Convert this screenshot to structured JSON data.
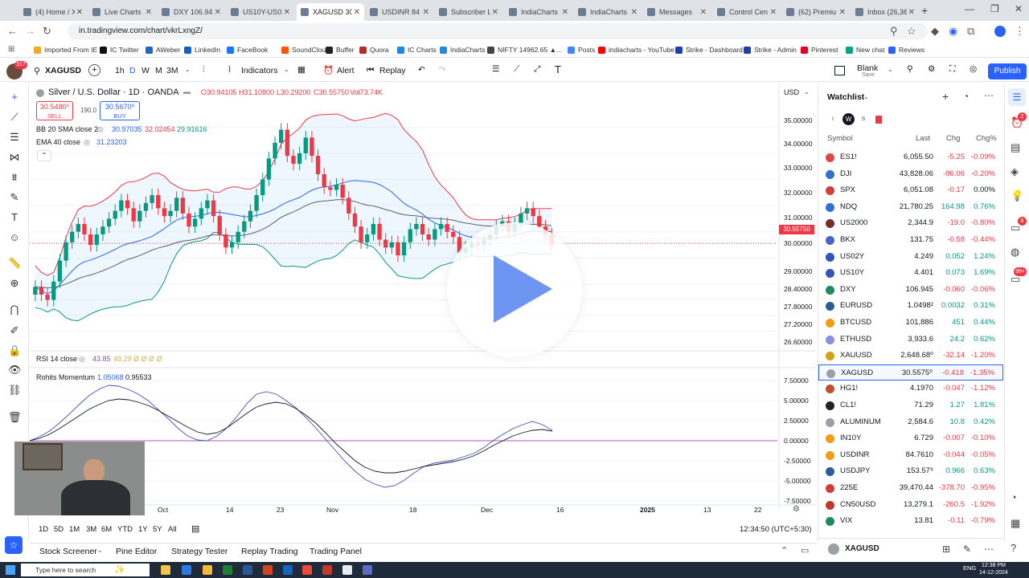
{
  "browser": {
    "tabs": [
      {
        "label": "(4) Home / X"
      },
      {
        "label": "Live Charts"
      },
      {
        "label": "DXY 106.94"
      },
      {
        "label": "US10Y-US02"
      },
      {
        "label": "XAGUSD 30"
      },
      {
        "label": "USDINR 84"
      },
      {
        "label": "Subscriber L"
      },
      {
        "label": "IndiaCharts"
      },
      {
        "label": "IndiaCharts"
      },
      {
        "label": "Messages"
      },
      {
        "label": "Control Cen"
      },
      {
        "label": "(62) Premiu"
      },
      {
        "label": "Inbox (26,36"
      }
    ],
    "url": "in.tradingview.com/chart/vkrLxngZ/",
    "bookmarks": [
      "Imported From IE",
      "IC Twitter",
      "AWeber",
      "LinkedIn",
      "FaceBook",
      "SoundCloud",
      "Buffer",
      "Quora",
      "IC Charts",
      "IndiaCharts",
      "NIFTY 14962.65 ▲...",
      "Posts",
      "indiacharts - YouTube",
      "Strike - Dashboard",
      "Strike - Admin",
      "Pinterest",
      "New chat",
      "Reviews"
    ]
  },
  "toolbar": {
    "symbol": "XAGUSD",
    "badge": "317",
    "intervals": [
      "1h",
      "D",
      "W",
      "M",
      "3M"
    ],
    "indicators": "Indicators",
    "alert": "Alert",
    "replay": "Replay",
    "layout_name": "Blank",
    "layout_sub": "Save",
    "publish": "Publish"
  },
  "chart": {
    "title": "Silver / U.S. Dollar · 1D · OANDA",
    "ohlc": {
      "o": "O30.94105",
      "h": "H31.10800",
      "l": "L30.29200",
      "c": "C30.55750",
      "vol": "Vol73.74K"
    },
    "sell_price": "30.5480⁰",
    "sell_label": "SELL",
    "spread": "190.0",
    "buy_price": "30.5670⁰",
    "buy_label": "BUY",
    "currency": "USD",
    "bb_label": "BB 20 SMA close 2",
    "bb_values": [
      "30.97035",
      "32.02454",
      "29.91616"
    ],
    "ema_label": "EMA 40 close",
    "ema_value": "31.23203",
    "rsi_label": "RSI 14 close",
    "rsi_value": "43.85",
    "rsi_extra": "48.29  Ø Ø Ø Ø",
    "mom_label": "Rohits Momentum",
    "mom_values": [
      "1.05068",
      "0.95533"
    ],
    "price_axis": [
      "35.00000",
      "34.00000",
      "33.00000",
      "32.00000",
      "31.00000",
      "30.00000",
      "29.00000",
      "28.40000",
      "27.80000",
      "27.20000",
      "26.60000"
    ],
    "last_price_tag": "30.55750",
    "mom_axis": [
      "7.50000",
      "5.00000",
      "2.50000",
      "0.00000",
      "-2.50000",
      "-5.00000",
      "-7.50000"
    ],
    "time_axis": [
      "Oct",
      "14",
      "23",
      "Nov",
      "18",
      "Dec",
      "16",
      "2025",
      "13",
      "22"
    ],
    "clock": "12:34:50 (UTC+5:30)",
    "ranges": [
      "1D",
      "5D",
      "1M",
      "3M",
      "6M",
      "YTD",
      "1Y",
      "5Y",
      "All"
    ]
  },
  "chart_data": [
    {
      "type": "candlestick",
      "title": "Silver / U.S. Dollar · 1D · OANDA",
      "y_range": [
        26.3,
        35.5
      ],
      "series": [
        {
          "name": "price_close_approx",
          "values": [
            28.9,
            28.6,
            28.4,
            29.1,
            29.9,
            30.6,
            31.0,
            31.3,
            30.9,
            30.5,
            30.9,
            31.2,
            31.5,
            31.8,
            32.2,
            31.9,
            31.4,
            31.8,
            32.1,
            32.4,
            31.9,
            31.6,
            31.8,
            32.3,
            31.7,
            31.2,
            31.5,
            31.9,
            32.2,
            31.6,
            30.9,
            30.4,
            30.6,
            31.0,
            31.4,
            31.8,
            32.4,
            33.0,
            33.8,
            34.4,
            34.9,
            33.9,
            33.6,
            34.0,
            34.6,
            33.9,
            33.2,
            32.7,
            32.6,
            32.8,
            32.3,
            31.7,
            31.2,
            30.6,
            30.9,
            31.3,
            30.7,
            30.4,
            30.6,
            30.1,
            30.6,
            31.1,
            31.3,
            30.9,
            30.7,
            31.1,
            31.3,
            31.0,
            30.8,
            30.2,
            30.4,
            30.6,
            30.5,
            30.7,
            30.9,
            31.2,
            31.4,
            31.0,
            31.3,
            31.7,
            31.9,
            31.6,
            31.2,
            30.9,
            30.5
          ]
        }
      ]
    },
    {
      "type": "line",
      "title": "Rohits Momentum",
      "y_range": [
        -7.5,
        7.5
      ],
      "series": [
        {
          "name": "1.05068",
          "values": [
            0.0,
            0.5,
            1.2,
            2.2,
            3.3,
            4.5,
            5.6,
            6.4,
            6.9,
            6.8,
            6.4,
            5.8,
            5.0,
            3.9,
            2.8,
            1.6,
            0.6,
            0.1,
            0.0,
            0.6,
            1.6,
            3.0,
            4.6,
            5.8,
            6.1,
            5.8,
            5.0,
            4.1,
            2.9,
            1.6,
            0.2,
            -1.2,
            -2.6,
            -3.8,
            -4.8,
            -5.4,
            -5.8,
            -5.6,
            -4.9,
            -4.0,
            -3.2,
            -2.8,
            -2.6,
            -2.4,
            -2.0,
            -1.6,
            -0.9,
            0.0,
            0.8,
            1.5,
            2.0,
            2.4,
            2.0,
            1.3
          ]
        },
        {
          "name": "0.95533",
          "values": [
            0.0,
            0.3,
            0.8,
            1.5,
            2.3,
            3.1,
            3.9,
            4.5,
            5.0,
            5.2,
            5.1,
            4.8,
            4.4,
            3.8,
            3.1,
            2.4,
            1.7,
            1.1,
            0.8,
            1.0,
            1.6,
            2.5,
            3.4,
            4.2,
            4.6,
            4.8,
            4.6,
            4.0,
            3.2,
            2.2,
            1.0,
            -0.3,
            -1.4,
            -2.5,
            -3.3,
            -3.8,
            -4.0,
            -4.0,
            -3.8,
            -3.5,
            -3.2,
            -3.0,
            -2.8,
            -2.6,
            -2.3,
            -1.9,
            -1.3,
            -0.6,
            0.0,
            0.6,
            1.0,
            1.3,
            1.4,
            1.2
          ]
        }
      ]
    }
  ],
  "watchlist": {
    "title": "Watchlist",
    "headers": [
      "Symbol",
      "Last",
      "Chg",
      "Chg%"
    ],
    "rows": [
      {
        "sym": "ES1!",
        "last": "6,055.50",
        "chg": "-5.25",
        "chgp": "-0.09%",
        "dir": "neg",
        "color": "#e04646"
      },
      {
        "sym": "DJI",
        "last": "43,828.06",
        "chg": "-86.06",
        "chgp": "-0.20%",
        "dir": "neg",
        "color": "#2f6fd8"
      },
      {
        "sym": "SPX",
        "last": "6,051.08",
        "chg": "-0.17",
        "chgp": "0.00%",
        "dir": "neg",
        "color": "#d43c3c"
      },
      {
        "sym": "NDQ",
        "last": "21,780.25",
        "chg": "164.98",
        "chgp": "0.76%",
        "dir": "pos",
        "color": "#2f6fd8"
      },
      {
        "sym": "US2000",
        "last": "2,344.9",
        "chg": "-19.0",
        "chgp": "-0.80%",
        "dir": "neg",
        "color": "#7a2b2b"
      },
      {
        "sym": "BKX",
        "last": "131.75",
        "chg": "-0.58",
        "chgp": "-0.44%",
        "dir": "neg",
        "color": "#4466cc"
      },
      {
        "sym": "US02Y",
        "last": "4.249",
        "chg": "0.052",
        "chgp": "1.24%",
        "dir": "pos",
        "color": "#3355bb"
      },
      {
        "sym": "US10Y",
        "last": "4.401",
        "chg": "0.073",
        "chgp": "1.69%",
        "dir": "pos",
        "color": "#3355bb"
      },
      {
        "sym": "DXY",
        "last": "106.945",
        "chg": "-0.060",
        "chgp": "-0.06%",
        "dir": "neg",
        "color": "#1f8a5a"
      },
      {
        "sym": "EURUSD",
        "last": "1.0498²",
        "chg": "0.0032",
        "chgp": "0.31%",
        "dir": "pos",
        "color": "#2a5d9c"
      },
      {
        "sym": "BTCUSD",
        "last": "101,886",
        "chg": "451",
        "chgp": "0.44%",
        "dir": "pos",
        "color": "#f39c12"
      },
      {
        "sym": "ETHUSD",
        "last": "3,933.6",
        "chg": "24.2",
        "chgp": "0.62%",
        "dir": "pos",
        "color": "#8a8fe0"
      },
      {
        "sym": "XAUUSD",
        "last": "2,648.68⁰",
        "chg": "-32.14",
        "chgp": "-1.20%",
        "dir": "neg",
        "color": "#d4a017"
      },
      {
        "sym": "XAGUSD",
        "last": "30.5575⁰",
        "chg": "-0.418",
        "chgp": "-1.35%",
        "dir": "neg",
        "color": "#9aa0a6",
        "selected": true
      },
      {
        "sym": "HG1!",
        "last": "4.1970",
        "chg": "-0.047",
        "chgp": "-1.12%",
        "dir": "neg",
        "color": "#c1502e"
      },
      {
        "sym": "CL1!",
        "last": "71.29",
        "chg": "1.27",
        "chgp": "1.81%",
        "dir": "pos",
        "color": "#222222"
      },
      {
        "sym": "ALUMINUM",
        "last": "2,584.6",
        "chg": "10.8",
        "chgp": "0.42%",
        "dir": "pos",
        "color": "#9aa0a6"
      },
      {
        "sym": "IN10Y",
        "last": "6.729",
        "chg": "-0.007",
        "chgp": "-0.10%",
        "dir": "neg",
        "color": "#f39c12"
      },
      {
        "sym": "USDINR",
        "last": "84.7610",
        "chg": "-0.044",
        "chgp": "-0.05%",
        "dir": "neg",
        "color": "#f39c12"
      },
      {
        "sym": "USDJPY",
        "last": "153.57⁹",
        "chg": "0.966",
        "chgp": "0.63%",
        "dir": "pos",
        "color": "#2a5d9c"
      },
      {
        "sym": "225E",
        "last": "39,470.44",
        "chg": "-378.70",
        "chgp": "-0.95%",
        "dir": "neg",
        "color": "#d43c3c"
      },
      {
        "sym": "CN50USD",
        "last": "13,279.1",
        "chg": "-260.5",
        "chgp": "-1.92%",
        "dir": "neg",
        "color": "#c0392b"
      },
      {
        "sym": "VIX",
        "last": "13.81",
        "chg": "-0.11",
        "chgp": "-0.79%",
        "dir": "neg",
        "color": "#1f8a5a"
      }
    ],
    "footer_symbol": "XAGUSD"
  },
  "bottom_tabs": [
    "Stock Screener",
    "Pine Editor",
    "Strategy Tester",
    "Replay Trading",
    "Trading Panel"
  ],
  "taskbar": {
    "search": "Type here to search",
    "time": "12:38 PM",
    "date": "14-12-2024",
    "lang": "ENG"
  }
}
